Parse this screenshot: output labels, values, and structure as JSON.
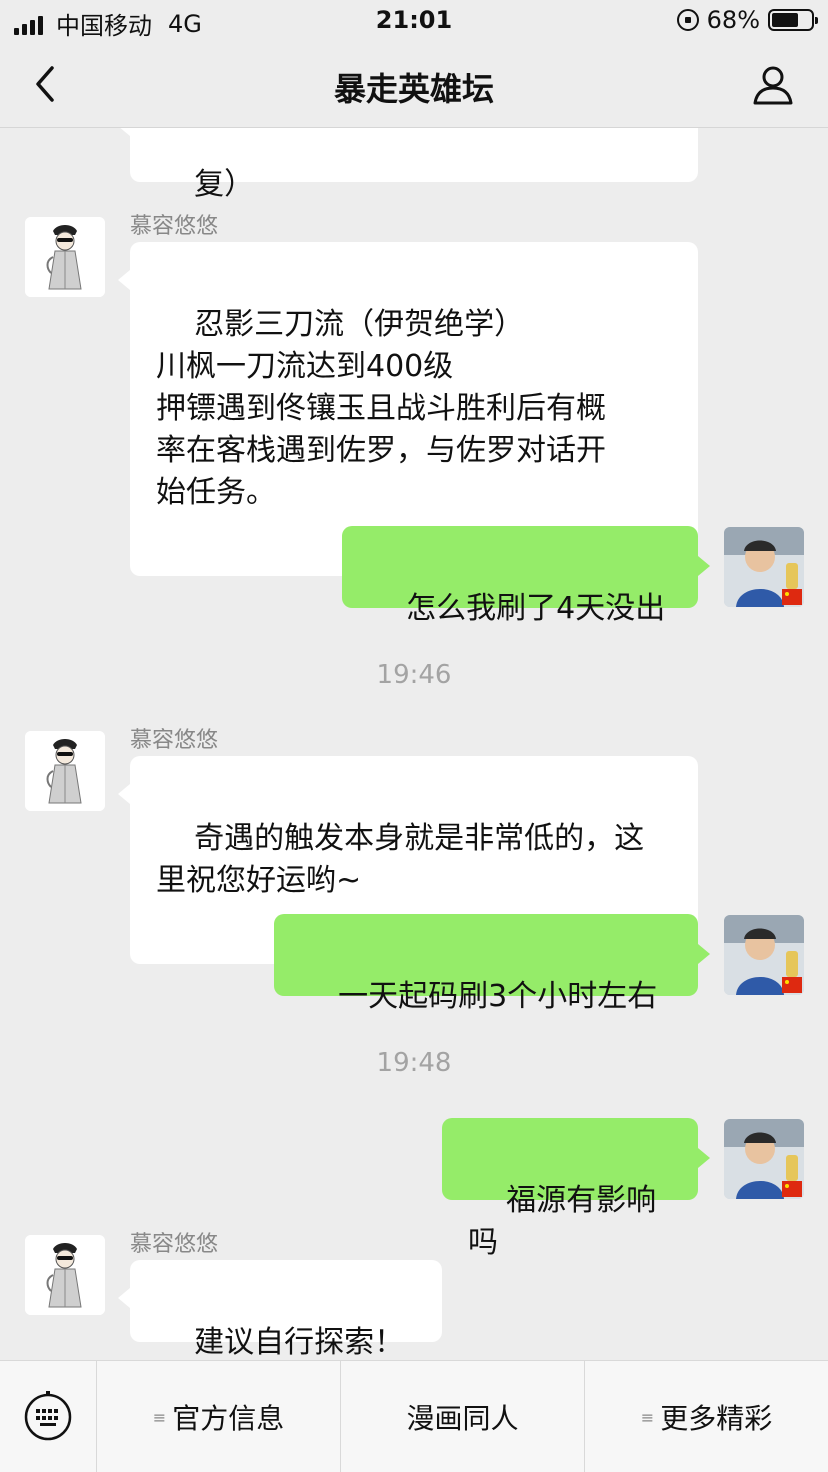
{
  "status_bar": {
    "carrier": "中国移动",
    "network": "4G",
    "time": "21:01",
    "battery_percent": "68%",
    "battery_level": 0.68
  },
  "nav": {
    "title": "暴走英雄坛"
  },
  "messages": [
    {
      "side": "in",
      "text": "复）"
    },
    {
      "side": "in",
      "sender": "慕容悠悠",
      "text": "忍影三刀流（伊贺绝学）\n川枫一刀流达到400级\n押镖遇到佟镶玉且战斗胜利后有概\n率在客栈遇到佐罗，与佐罗对话开\n始任务。"
    },
    {
      "side": "out",
      "text": "怎么我刷了4天没出"
    },
    {
      "timestamp": "19:46"
    },
    {
      "side": "in",
      "sender": "慕容悠悠",
      "text": "奇遇的触发本身就是非常低的，这\n里祝您好运哟~"
    },
    {
      "side": "out",
      "text": "一天起码刷3个小时左右"
    },
    {
      "timestamp": "19:48"
    },
    {
      "side": "out",
      "text": "福源有影响吗"
    },
    {
      "side": "in",
      "sender": "慕容悠悠",
      "text": "建议自行探索！~"
    }
  ],
  "bottom_menu": [
    {
      "label": "官方信息",
      "icon": "≡"
    },
    {
      "label": "漫画同人",
      "icon": ""
    },
    {
      "label": "更多精彩",
      "icon": "≡"
    }
  ],
  "colors": {
    "background": "#ededed",
    "outgoing_bubble": "#95ec69",
    "incoming_bubble": "#ffffff"
  }
}
